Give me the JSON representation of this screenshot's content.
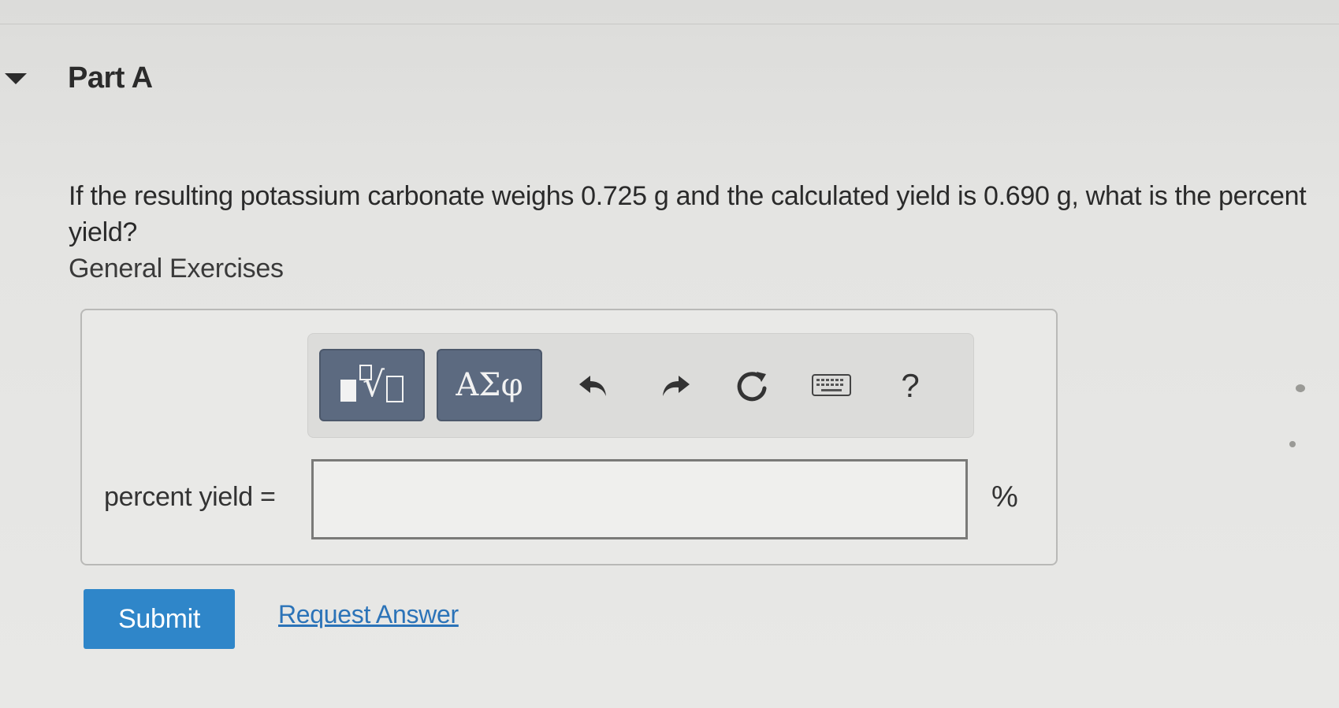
{
  "part": {
    "title": "Part A"
  },
  "question": {
    "text": "If the resulting potassium carbonate weighs 0.725 g and the calculated yield is 0.690 g, what is the percent yield?",
    "subtitle": "General Exercises"
  },
  "toolbar": {
    "greek_label": "ΑΣφ",
    "help_label": "?",
    "icons": [
      "templates-icon",
      "undo-icon",
      "redo-icon",
      "reset-icon",
      "keyboard-icon",
      "help-icon"
    ]
  },
  "answer": {
    "label": "percent yield =",
    "value": "",
    "unit": "%"
  },
  "actions": {
    "submit_label": "Submit",
    "request_answer_label": "Request Answer"
  },
  "colors": {
    "submit": "#2f86c9",
    "link": "#2b73b8",
    "toolbar_button": "#5c6a80"
  }
}
